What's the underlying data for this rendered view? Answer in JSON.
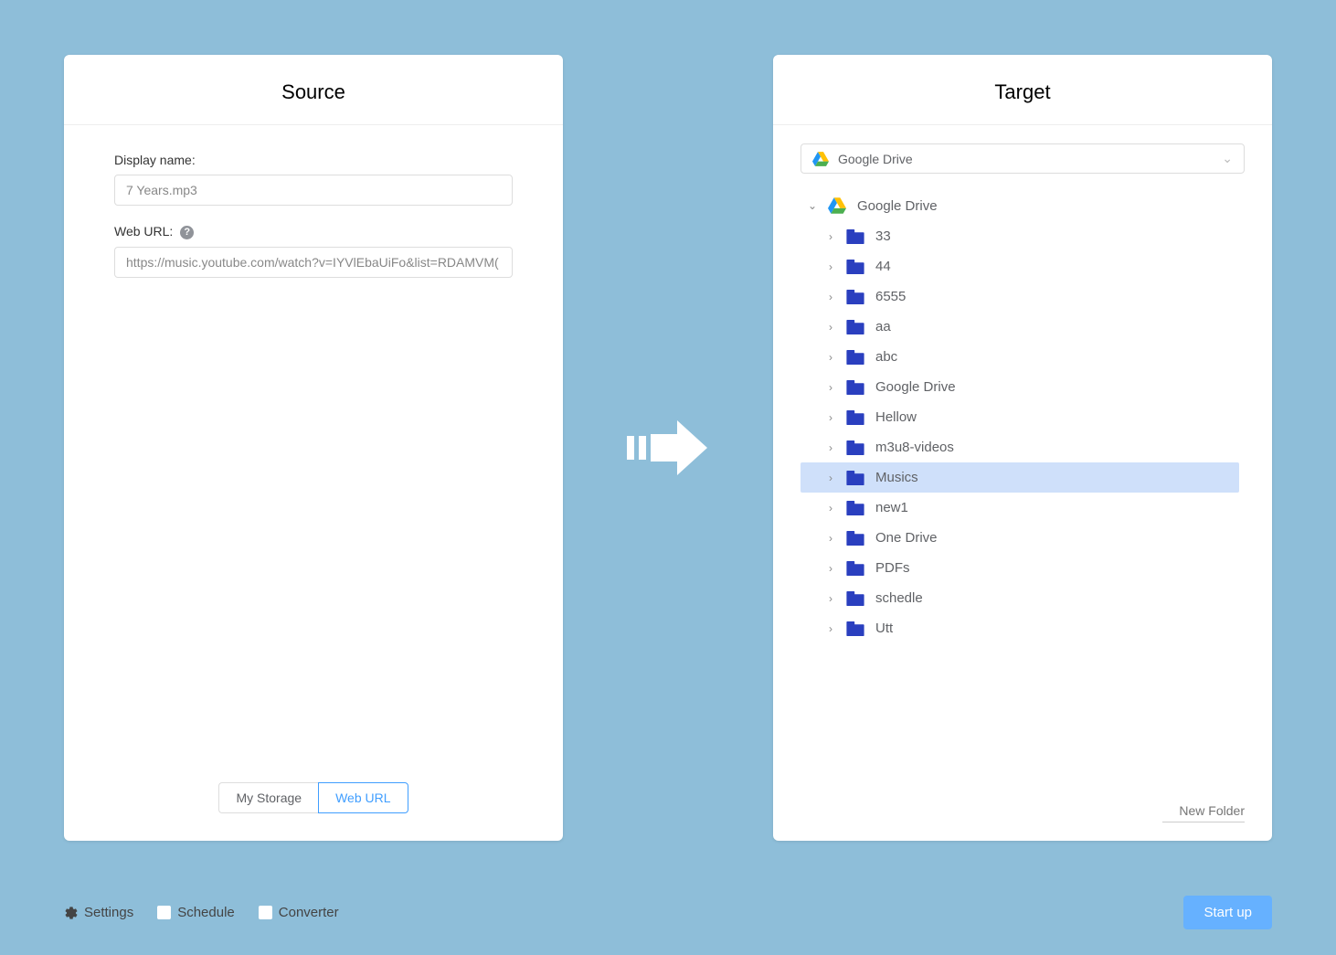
{
  "source": {
    "title": "Source",
    "display_name_label": "Display name:",
    "display_name_value": "7 Years.mp3",
    "web_url_label": "Web URL:",
    "web_url_value": "https://music.youtube.com/watch?v=IYVlEbaUiFo&list=RDAMVM(",
    "tabs": {
      "my_storage": "My Storage",
      "web_url": "Web URL"
    }
  },
  "target": {
    "title": "Target",
    "drive_select_label": "Google Drive",
    "root_label": "Google Drive",
    "folders": [
      {
        "name": "33",
        "selected": false
      },
      {
        "name": "44",
        "selected": false
      },
      {
        "name": "6555",
        "selected": false
      },
      {
        "name": "aa",
        "selected": false
      },
      {
        "name": "abc",
        "selected": false
      },
      {
        "name": "Google Drive",
        "selected": false
      },
      {
        "name": "Hellow",
        "selected": false
      },
      {
        "name": "m3u8-videos",
        "selected": false
      },
      {
        "name": "Musics",
        "selected": true
      },
      {
        "name": "new1",
        "selected": false
      },
      {
        "name": "One Drive",
        "selected": false
      },
      {
        "name": "PDFs",
        "selected": false
      },
      {
        "name": "schedle",
        "selected": false
      },
      {
        "name": "Utt",
        "selected": false
      }
    ],
    "new_folder_placeholder": "New Folder"
  },
  "footer": {
    "settings": "Settings",
    "schedule": "Schedule",
    "converter": "Converter",
    "start_up": "Start up"
  }
}
